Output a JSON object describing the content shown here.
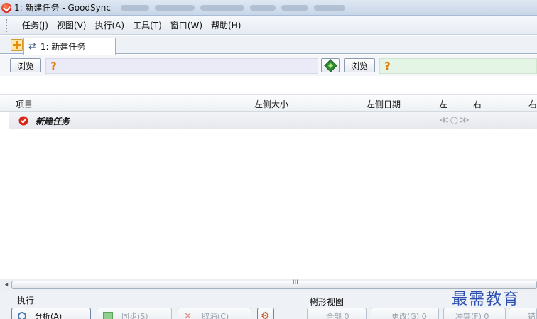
{
  "window": {
    "title": "1: 新建任务 - GoodSync"
  },
  "menu": {
    "items": [
      "任务(J)",
      "视图(V)",
      "执行(A)",
      "工具(T)",
      "窗口(W)",
      "帮助(H)"
    ]
  },
  "tabs": {
    "active_label": "1: 新建任务"
  },
  "browse": {
    "left_button": "浏览",
    "left_path": "?",
    "right_button": "浏览",
    "right_path": "?"
  },
  "columns": {
    "item": "项目",
    "left_size": "左侧大小",
    "left_date": "左侧日期",
    "left": "左",
    "right": "右",
    "right_cut": "右"
  },
  "job": {
    "label": "新建任务",
    "status_glyphs": "≪○≫"
  },
  "scrollbar": {
    "grip": "III",
    "left_arrow": "◂"
  },
  "bottom": {
    "execute_label": "执行",
    "tree_view_label": "树形视图",
    "analyze_button": "分析(A)",
    "sync_button": "同步(S)",
    "cancel_button": "取消(C)",
    "all_button": "全部 0",
    "changed_button": "更改(G) 0",
    "conflict_button": "冲突(F) 0",
    "error_button_cut": "错"
  },
  "watermark": "最需教育",
  "colors": {
    "left_path_bg": "#ebebf8",
    "right_path_bg": "#e5f5e5",
    "question_mark": "#e07a00",
    "watermark": "#2d4fb0"
  }
}
